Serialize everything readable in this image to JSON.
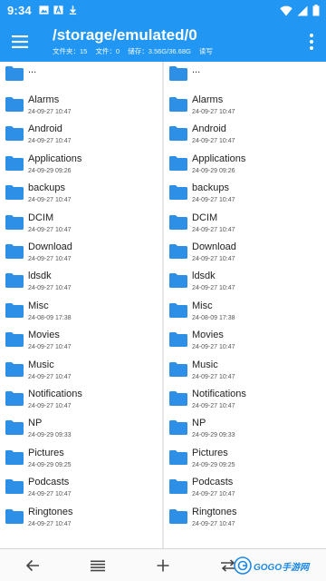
{
  "status_bar": {
    "time": "9:34",
    "left_icons": [
      "image-icon",
      "text-a-icon",
      "download-icon"
    ],
    "right_icons": [
      "wifi-icon",
      "signal-icon",
      "battery-icon"
    ]
  },
  "header": {
    "path": "/storage/emulated/0",
    "info": {
      "folders": "文件夹：15",
      "files": "文件：0",
      "storage": "储存：3.56G/36.68G",
      "mode": "读写"
    },
    "menu_icon": "hamburger-icon",
    "overflow_icon": "more-vert-icon"
  },
  "colors": {
    "primary": "#2196f3",
    "folder": "#2d8fe6"
  },
  "panes": {
    "left": {
      "parent": "...",
      "items": [
        {
          "name": "Alarms",
          "date": "24-09-27 10:47"
        },
        {
          "name": "Android",
          "date": "24-09-27 10:47"
        },
        {
          "name": "Applications",
          "date": "24-09-29 09:26"
        },
        {
          "name": "backups",
          "date": "24-09-27 10:47"
        },
        {
          "name": "DCIM",
          "date": "24-09-27 10:47"
        },
        {
          "name": "Download",
          "date": "24-09-27 10:47"
        },
        {
          "name": "ldsdk",
          "date": "24-09-27 10:47"
        },
        {
          "name": "Misc",
          "date": "24-08-09 17:38"
        },
        {
          "name": "Movies",
          "date": "24-09-27 10:47"
        },
        {
          "name": "Music",
          "date": "24-09-27 10:47"
        },
        {
          "name": "Notifications",
          "date": "24-09-27 10:47"
        },
        {
          "name": "NP",
          "date": "24-09-29 09:33"
        },
        {
          "name": "Pictures",
          "date": "24-09-29 09:25"
        },
        {
          "name": "Podcasts",
          "date": "24-09-27 10:47"
        },
        {
          "name": "Ringtones",
          "date": "24-09-27 10:47"
        }
      ]
    },
    "right": {
      "parent": "...",
      "items": [
        {
          "name": "Alarms",
          "date": "24-09-27 10:47"
        },
        {
          "name": "Android",
          "date": "24-09-27 10:47"
        },
        {
          "name": "Applications",
          "date": "24-09-29 09:26"
        },
        {
          "name": "backups",
          "date": "24-09-27 10:47"
        },
        {
          "name": "DCIM",
          "date": "24-09-27 10:47"
        },
        {
          "name": "Download",
          "date": "24-09-27 10:47"
        },
        {
          "name": "ldsdk",
          "date": "24-09-27 10:47"
        },
        {
          "name": "Misc",
          "date": "24-08-09 17:38"
        },
        {
          "name": "Movies",
          "date": "24-09-27 10:47"
        },
        {
          "name": "Music",
          "date": "24-09-27 10:47"
        },
        {
          "name": "Notifications",
          "date": "24-09-27 10:47"
        },
        {
          "name": "NP",
          "date": "24-09-29 09:33"
        },
        {
          "name": "Pictures",
          "date": "24-09-29 09:25"
        },
        {
          "name": "Podcasts",
          "date": "24-09-27 10:47"
        },
        {
          "name": "Ringtones",
          "date": "24-09-27 10:47"
        }
      ]
    }
  },
  "bottom_bar": {
    "buttons": [
      "back-arrow-icon",
      "list-icon",
      "add-icon",
      "swap-icon"
    ],
    "watermark": "GOGO手游网"
  }
}
